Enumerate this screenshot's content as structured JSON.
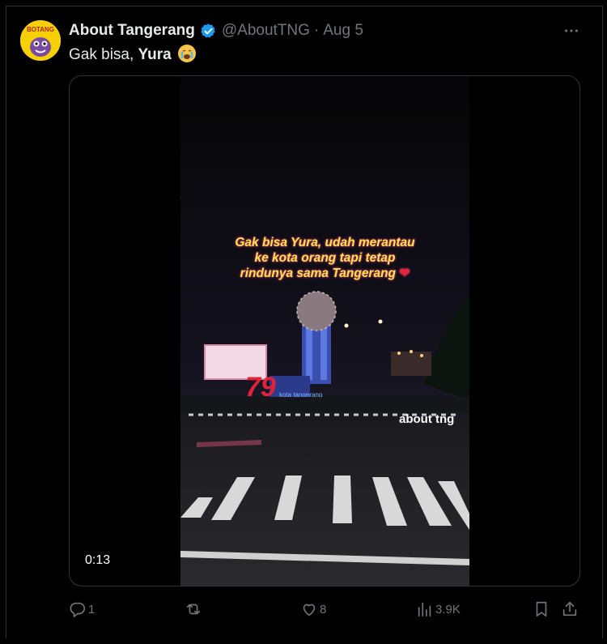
{
  "author": {
    "name": "About Tangerang",
    "handle": "@AboutTNG",
    "separator": "·",
    "date": "Aug 5",
    "avatar_text": "BOTANG"
  },
  "tweet": {
    "text_prefix": "Gak bisa, ",
    "text_bold": "Yura",
    "emoji": "crying-face-emoji"
  },
  "video": {
    "duration": "0:13",
    "caption_lines": [
      "Gak bisa Yura, udah merantau",
      "ke kota orang tapi tetap",
      "rindunya sama Tangerang"
    ],
    "watermark": "about tng",
    "sign_text": "79",
    "sign_label": "kota tangerang"
  },
  "actions": {
    "replies": "1",
    "reposts": "",
    "likes": "8",
    "views": "3.9K"
  },
  "colors": {
    "background": "#000000",
    "text": "#e7e9ea",
    "muted": "#71767b",
    "verified": "#1d9bf0",
    "caption": "#ffe34f"
  }
}
